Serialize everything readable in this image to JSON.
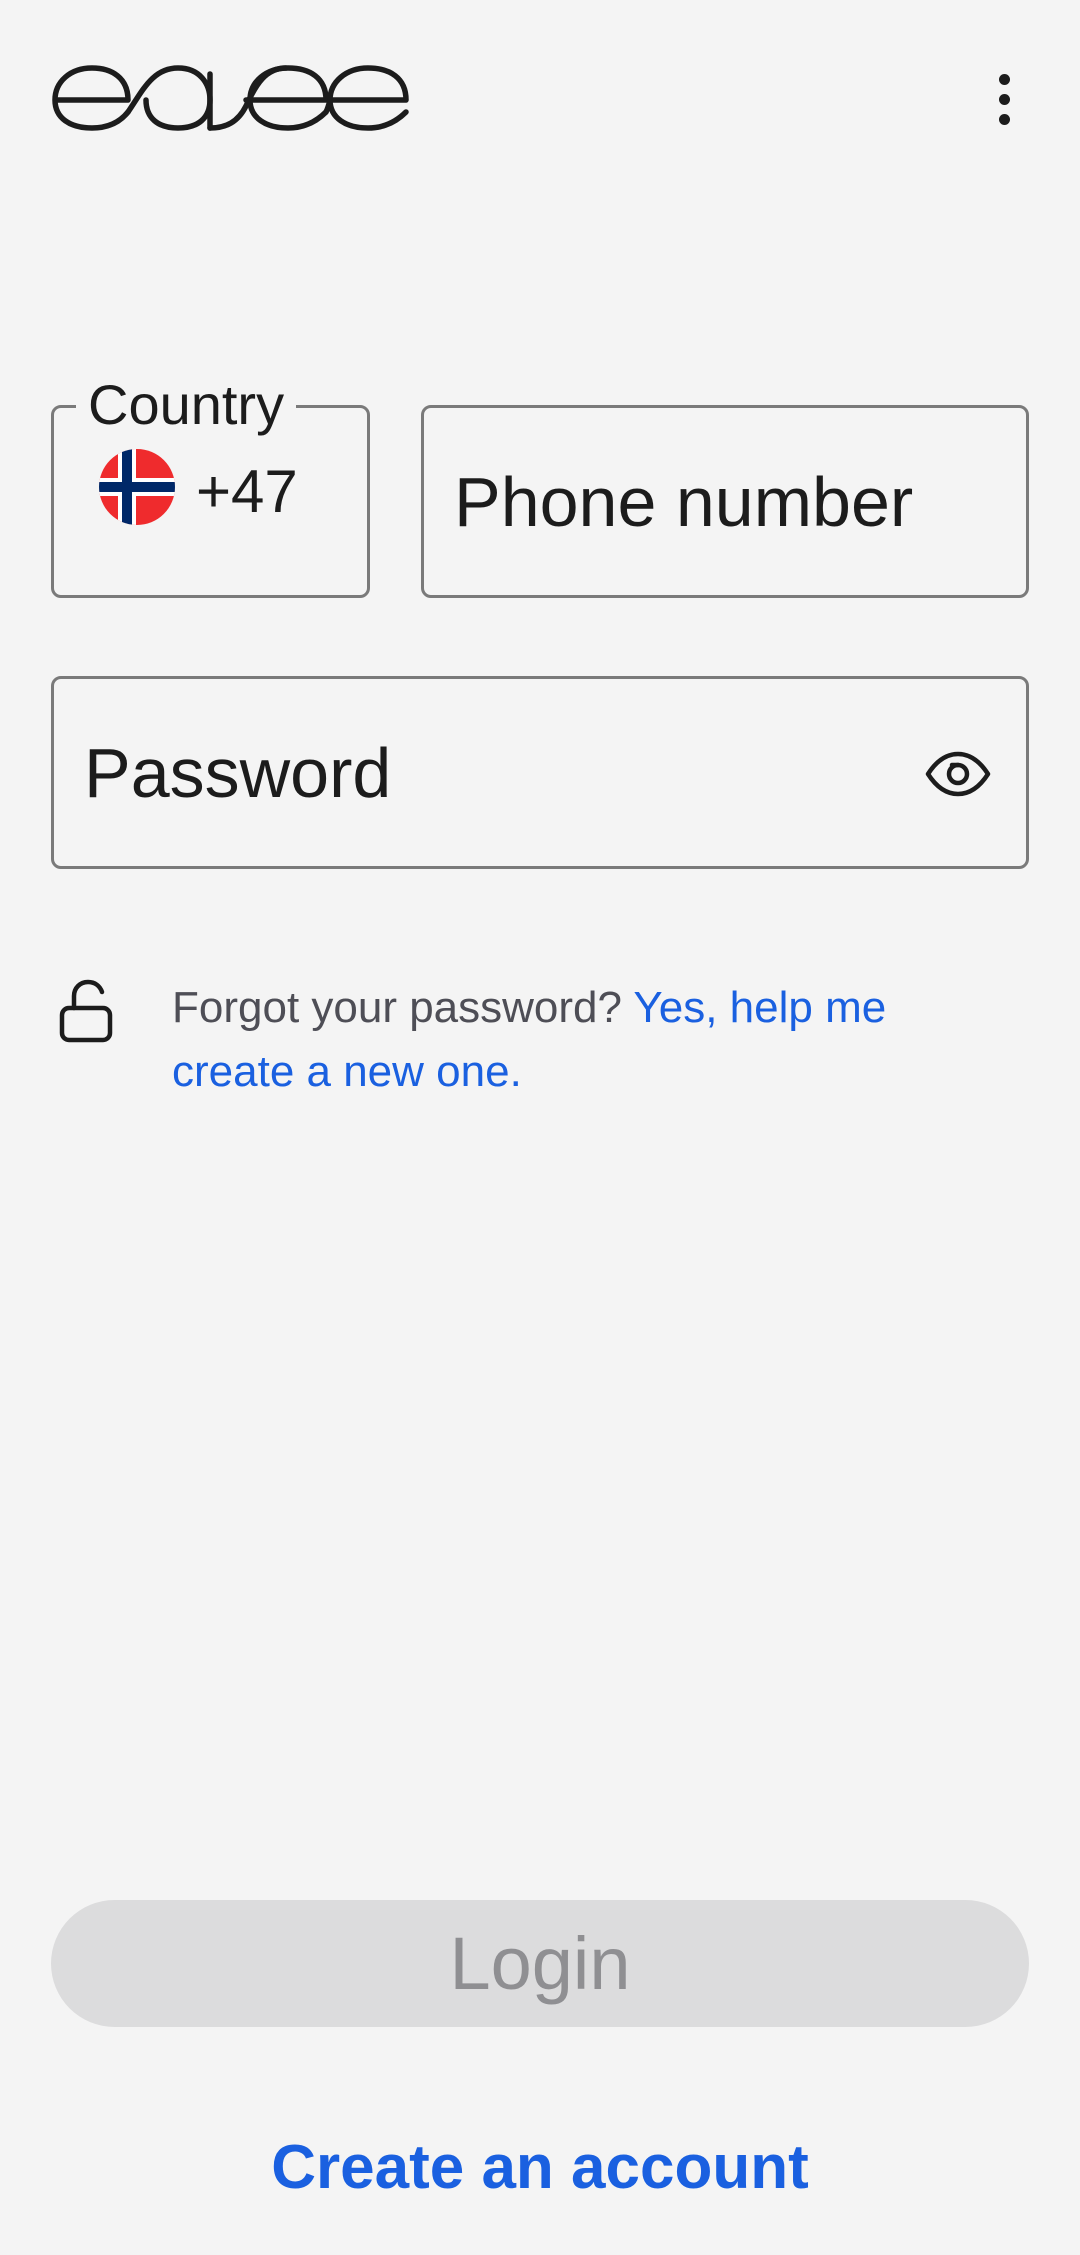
{
  "header": {
    "logo_text": "easee",
    "menu_icon": "more-vertical-icon"
  },
  "login_form": {
    "country": {
      "label": "Country",
      "flag_icon": "norway-flag-icon",
      "dial_code": "+47"
    },
    "phone": {
      "placeholder": "Phone number",
      "value": ""
    },
    "password": {
      "placeholder": "Password",
      "value": "",
      "toggle_icon": "eye-icon"
    },
    "forgot_password": {
      "icon": "unlock-icon",
      "prompt": "Forgot your password? ",
      "link_text": "Yes, help me create a new one."
    },
    "login_label": "Login",
    "create_account_label": "Create an account"
  },
  "colors": {
    "background": "#f4f4f4",
    "link": "#1a60e0",
    "disabled_button": "#dcdcdd",
    "disabled_text": "#8f8f92"
  }
}
